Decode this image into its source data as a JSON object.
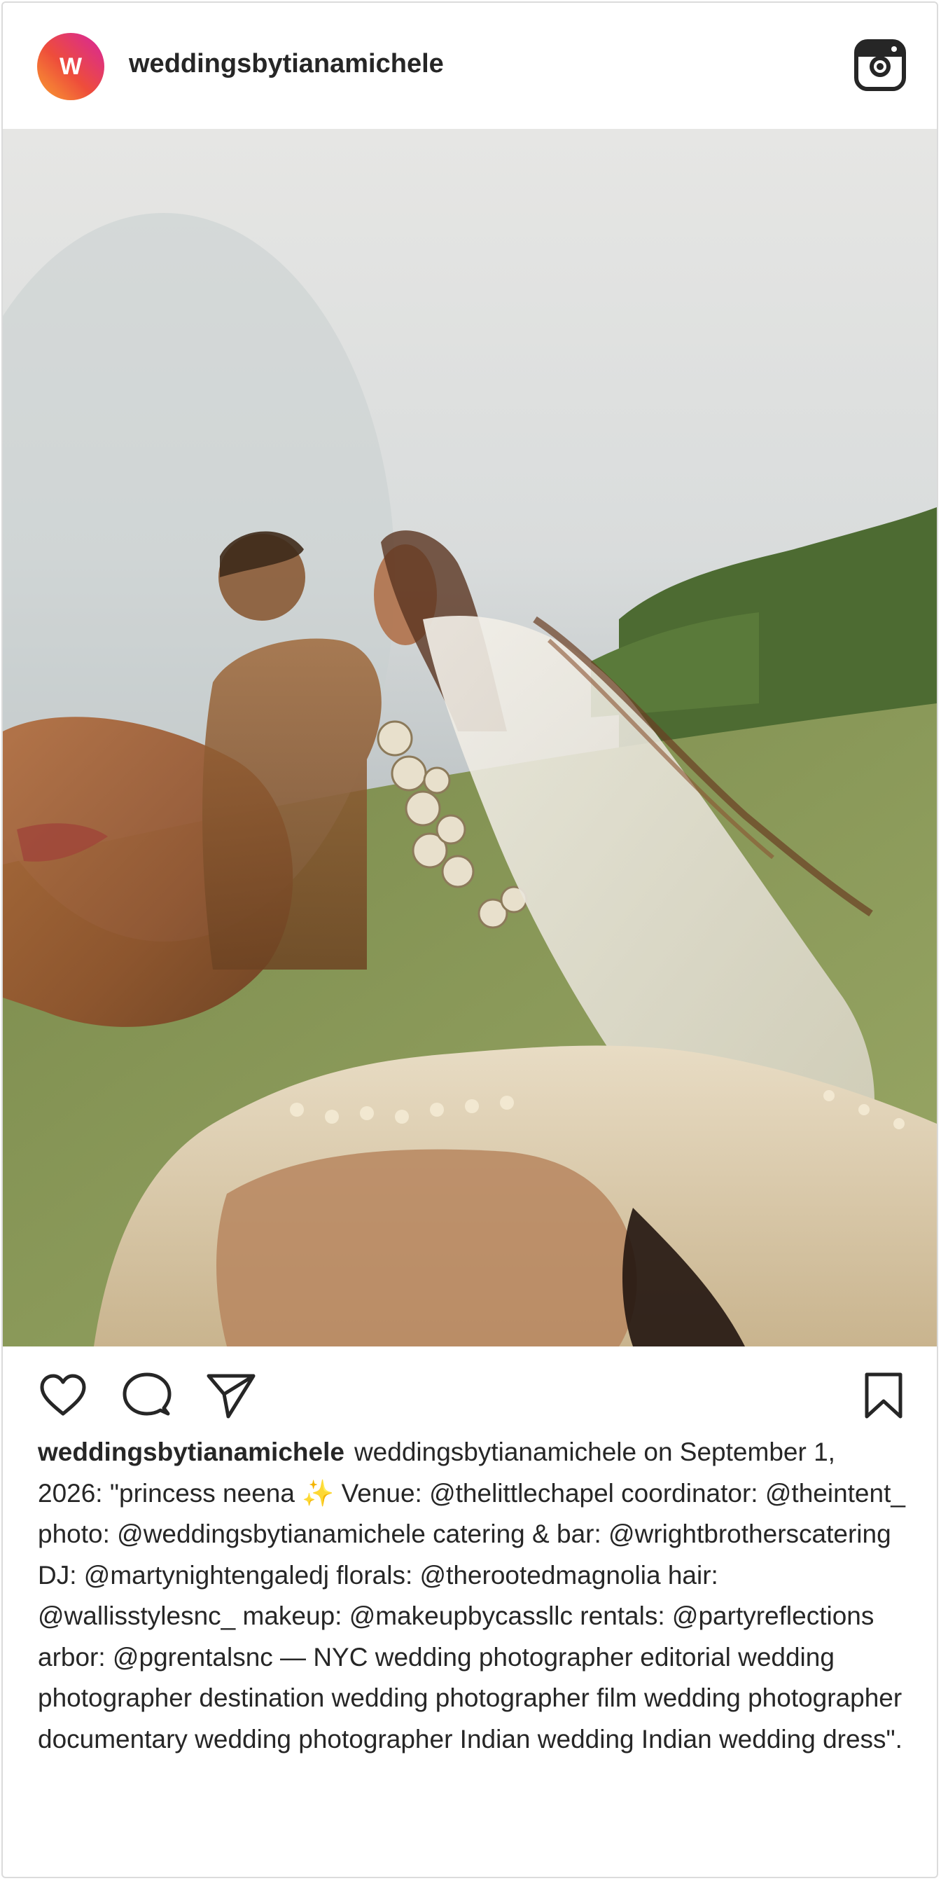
{
  "post": {
    "avatar_letter": "W",
    "username": "weddingsbytianamichele",
    "caption_username": "weddingsbytianamichele",
    "caption_text": "weddingsbytianamichele on September 1, 2026: \"princess neena ✨ Venue: @thelittlechapel coordinator: @theintent_ photo: @weddingsbytianamichele catering & bar: @wrightbrotherscatering DJ: @martynightengaledj florals: @therootedmagnolia hair: @wallisstylesnc_ makeup: @makeupbycassllc rentals: @partyreflections arbor: @pgrentalsnc — NYC wedding photographer editorial wedding photographer destination wedding photographer film wedding photographer documentary wedding photographer Indian wedding Indian wedding dress\"."
  },
  "icons": {
    "brand": "instagram-icon",
    "like": "heart-icon",
    "comment": "comment-icon",
    "share": "paper-plane-icon",
    "save": "bookmark-icon"
  },
  "colors": {
    "avatar_gradient_start": "#f9a030",
    "avatar_gradient_end": "#d6249f",
    "text": "#262626",
    "border": "#dbdbdb"
  }
}
